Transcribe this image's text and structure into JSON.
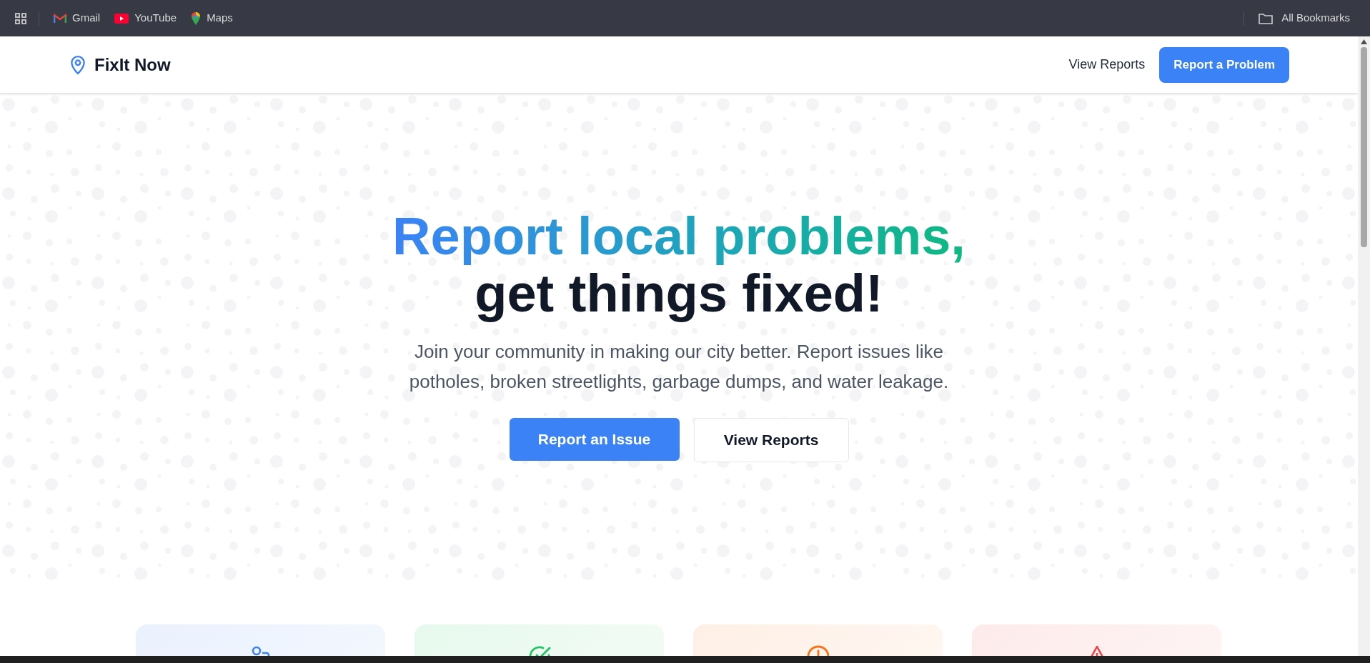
{
  "bookmarks_bar": {
    "items": [
      {
        "kind": "gmail",
        "label": "Gmail"
      },
      {
        "kind": "youtube",
        "label": "YouTube"
      },
      {
        "kind": "maps",
        "label": "Maps"
      }
    ],
    "all_bookmarks": "All Bookmarks"
  },
  "header": {
    "logo": "FixIt Now",
    "nav_link": "View Reports",
    "cta": "Report a Problem"
  },
  "hero": {
    "headline_gradient": "Report local problems,",
    "headline": "get things fixed!",
    "subtitle": "Join your community in making our city better. Report issues like potholes, broken streetlights, garbage dumps, and water leakage.",
    "primary_button": "Report an Issue",
    "secondary_button": "View Reports"
  },
  "cards": [
    {
      "kind": "users",
      "color": "#3b82f6"
    },
    {
      "kind": "check",
      "color": "#22c55e"
    },
    {
      "kind": "clock",
      "color": "#f97316"
    },
    {
      "kind": "alert",
      "color": "#ef4444"
    }
  ]
}
